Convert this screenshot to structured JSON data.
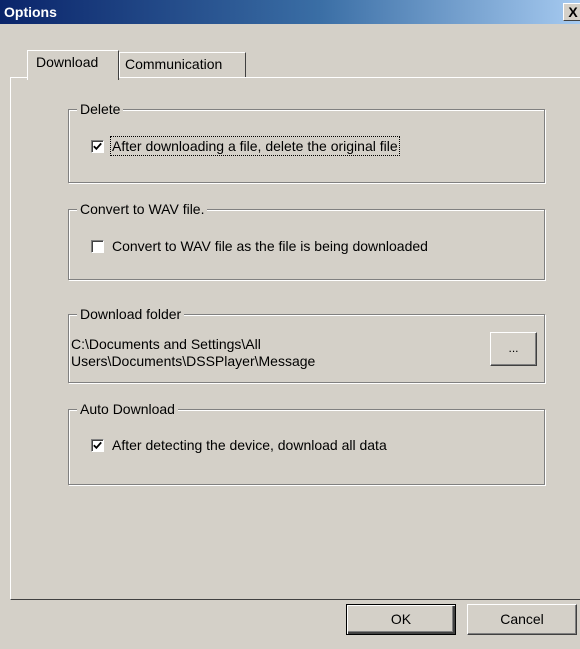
{
  "window": {
    "title": "Options",
    "close_glyph": "X"
  },
  "tabs": [
    {
      "label": "Download",
      "active": true
    },
    {
      "label": "Communication",
      "active": false
    }
  ],
  "groups": {
    "delete": {
      "legend": "Delete",
      "checkbox_label": "After downloading a file, delete the original file",
      "checked": true
    },
    "convert": {
      "legend": "Convert to WAV file.",
      "checkbox_label": "Convert to WAV file as the file is being downloaded",
      "checked": false
    },
    "download_folder": {
      "legend": "Download folder",
      "path_line1": "C:\\Documents and Settings\\All",
      "path_line2": "Users\\Documents\\DSSPlayer\\Message",
      "browse_label": "..."
    },
    "auto_download": {
      "legend": "Auto Download",
      "checkbox_label": "After detecting the device, download all data",
      "checked": true
    }
  },
  "buttons": {
    "ok": "OK",
    "cancel": "Cancel"
  },
  "icons": {
    "close": "close-icon",
    "check": "checkmark-icon"
  }
}
